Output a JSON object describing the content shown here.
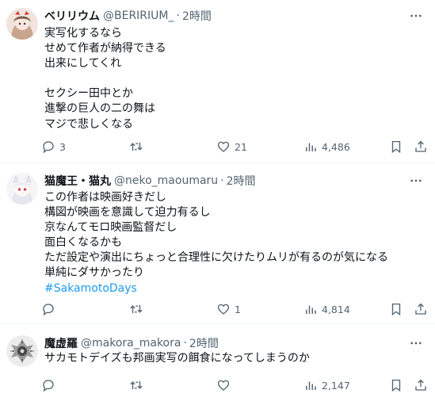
{
  "tweets": [
    {
      "name": "ベリリウム",
      "handle": "@BERIRIUM_",
      "separator": "·",
      "time": "2時間",
      "lines": [
        "実写化するなら",
        "せめて作者が納得できる",
        "出来にしてくれ",
        "",
        "セクシー田中とか",
        "進撃の巨人の二の舞は",
        "マジで悲しくなる"
      ],
      "hashtag": "",
      "replies": "3",
      "retweets": "",
      "likes": "21",
      "views": "4,486"
    },
    {
      "name": "猫魔王・猫丸",
      "handle": "@neko_maoumaru",
      "separator": "·",
      "time": "2時間",
      "lines": [
        "この作者は映画好きだし",
        "構図が映画を意識して迫力有るし",
        "京なんてモロ映画監督だし",
        "面白くなるかも",
        "ただ設定や演出にちょっと合理性に欠けたりムリが有るのが気になる",
        "単純にダサかったり"
      ],
      "hashtag": "#SakamotoDays",
      "replies": "",
      "retweets": "",
      "likes": "1",
      "views": "4,814"
    },
    {
      "name": "魔虚羅",
      "handle": "@makora_makora",
      "separator": "·",
      "time": "2時間",
      "lines": [
        "サカモトデイズも邦画実写の餌食になってしまうのか"
      ],
      "hashtag": "",
      "replies": "",
      "retweets": "",
      "likes": "",
      "views": "2,147"
    }
  ],
  "icons": {
    "more": "more-horizontal-icon",
    "reply": "reply-bubble-icon",
    "retweet": "retweet-arrows-icon",
    "like": "heart-icon",
    "views": "views-bar-chart-icon",
    "bookmark": "bookmark-icon",
    "share": "share-upload-icon"
  },
  "colors": {
    "text": "#0f1419",
    "secondary": "#536471",
    "link": "#1d9bf0",
    "divider": "#eff3f4"
  }
}
